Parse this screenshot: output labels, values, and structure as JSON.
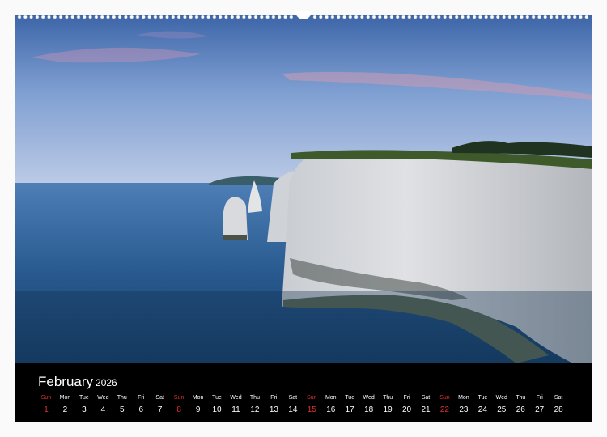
{
  "calendar": {
    "month": "February",
    "year": "2026",
    "days": [
      {
        "weekday": "Sun",
        "date": "1"
      },
      {
        "weekday": "Mon",
        "date": "2"
      },
      {
        "weekday": "Tue",
        "date": "3"
      },
      {
        "weekday": "Wed",
        "date": "4"
      },
      {
        "weekday": "Thu",
        "date": "5"
      },
      {
        "weekday": "Fri",
        "date": "6"
      },
      {
        "weekday": "Sat",
        "date": "7"
      },
      {
        "weekday": "Sun",
        "date": "8"
      },
      {
        "weekday": "Mon",
        "date": "9"
      },
      {
        "weekday": "Tue",
        "date": "10"
      },
      {
        "weekday": "Wed",
        "date": "11"
      },
      {
        "weekday": "Thu",
        "date": "12"
      },
      {
        "weekday": "Fri",
        "date": "13"
      },
      {
        "weekday": "Sat",
        "date": "14"
      },
      {
        "weekday": "Sun",
        "date": "15"
      },
      {
        "weekday": "Mon",
        "date": "16"
      },
      {
        "weekday": "Tue",
        "date": "17"
      },
      {
        "weekday": "Wed",
        "date": "18"
      },
      {
        "weekday": "Thu",
        "date": "19"
      },
      {
        "weekday": "Fri",
        "date": "20"
      },
      {
        "weekday": "Sat",
        "date": "21"
      },
      {
        "weekday": "Sun",
        "date": "22"
      },
      {
        "weekday": "Mon",
        "date": "23"
      },
      {
        "weekday": "Tue",
        "date": "24"
      },
      {
        "weekday": "Wed",
        "date": "25"
      },
      {
        "weekday": "Thu",
        "date": "26"
      },
      {
        "weekday": "Fri",
        "date": "27"
      },
      {
        "weekday": "Sat",
        "date": "28"
      }
    ]
  },
  "colors": {
    "band": "#000000",
    "text": "#ffffff",
    "sunday": "#e03030",
    "sky_top": "#3f67a8",
    "sea": "#1f4f80"
  },
  "icons": {
    "binding": "spiral-binding-icon",
    "photo": "coastal-cliffs-photo"
  }
}
